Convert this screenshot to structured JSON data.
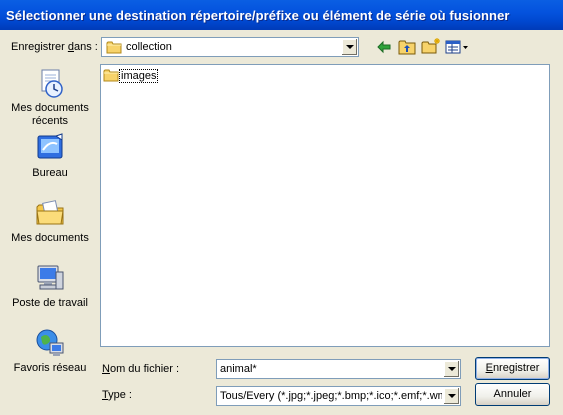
{
  "window": {
    "title": "Sélectionner une destination répertoire/préfixe ou élément de série où fusionner"
  },
  "save_in": {
    "label_prefix": "Enregistrer ",
    "label_accel": "d",
    "label_suffix": "ans :",
    "value": "collection"
  },
  "places": [
    {
      "label_line1": "Mes documents",
      "label_line2": "récents",
      "icon": "recent-documents-icon"
    },
    {
      "label_line1": "Bureau",
      "label_line2": "",
      "icon": "desktop-icon"
    },
    {
      "label_line1": "Mes documents",
      "label_line2": "",
      "icon": "my-documents-icon"
    },
    {
      "label_line1": "Poste de travail",
      "label_line2": "",
      "icon": "my-computer-icon"
    },
    {
      "label_line1": "Favoris réseau",
      "label_line2": "",
      "icon": "network-places-icon"
    }
  ],
  "files": [
    {
      "name": "images",
      "icon": "folder-icon"
    }
  ],
  "filename": {
    "label_accel": "N",
    "label_rest": "om du fichier :",
    "value": "animal*"
  },
  "filetype": {
    "label_accel": "T",
    "label_rest": "ype :",
    "value": "Tous/Every (*.jpg;*.jpeg;*.bmp;*.ico;*.emf;*.wml"
  },
  "buttons": {
    "save_accel": "E",
    "save_rest": "nregistrer",
    "cancel": "Annuler"
  }
}
